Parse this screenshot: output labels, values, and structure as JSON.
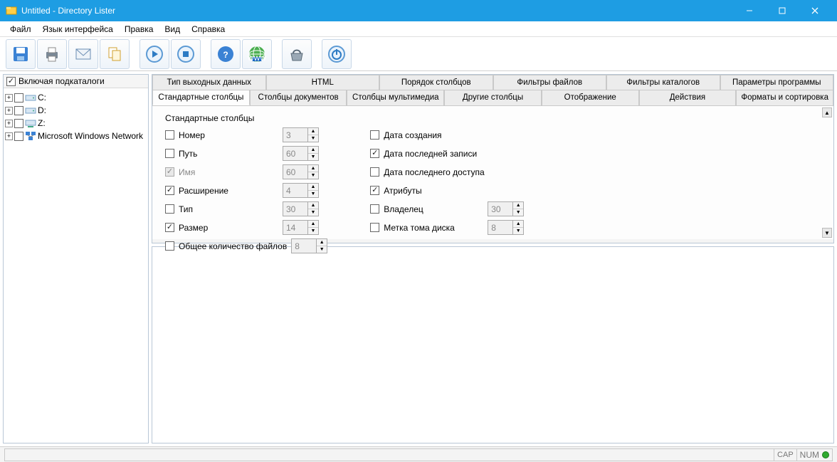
{
  "window": {
    "title": "Untitled - Directory Lister"
  },
  "menu": {
    "file": "Файл",
    "language": "Язык интерфейса",
    "edit": "Правка",
    "view": "Вид",
    "help": "Справка"
  },
  "toolbar_icons": {
    "save": "save-icon",
    "print": "print-icon",
    "email": "email-icon",
    "copy": "copy-icon",
    "run": "run-icon",
    "stop": "stop-icon",
    "help": "help-icon",
    "web": "web-icon",
    "basket": "basket-icon",
    "power": "power-icon"
  },
  "sidebar": {
    "include_subdirs": "Включая подкаталоги",
    "nodes": [
      {
        "label": "C:"
      },
      {
        "label": "D:"
      },
      {
        "label": "Z:"
      },
      {
        "label": "Microsoft Windows Network"
      }
    ]
  },
  "tabs": {
    "row1": [
      "Тип выходных данных",
      "HTML",
      "Порядок столбцов",
      "Фильтры файлов",
      "Фильтры каталогов",
      "Параметры программы"
    ],
    "row2": [
      "Стандартные столбцы",
      "Столбцы документов",
      "Столбцы мультимедиа",
      "Другие столбцы",
      "Отображение",
      "Действия",
      "Форматы и сортировка"
    ],
    "active": "Стандартные столбцы"
  },
  "group": {
    "title": "Стандартные столбцы"
  },
  "fields": {
    "number": {
      "label": "Номер",
      "checked": false,
      "value": "3",
      "enabled_spin": false
    },
    "path": {
      "label": "Путь",
      "checked": false,
      "value": "60",
      "enabled_spin": false
    },
    "name": {
      "label": "Имя",
      "checked": true,
      "disabled": true,
      "value": "60",
      "enabled_spin": false
    },
    "extension": {
      "label": "Расширение",
      "checked": true,
      "value": "4",
      "enabled_spin": false
    },
    "type": {
      "label": "Тип",
      "checked": false,
      "value": "30",
      "enabled_spin": false
    },
    "size": {
      "label": "Размер",
      "checked": true,
      "value": "14",
      "enabled_spin": false
    },
    "total_files": {
      "label": "Общее количество файлов",
      "checked": false,
      "value": "8",
      "enabled_spin": false
    },
    "date_created": {
      "label": "Дата создания",
      "checked": false
    },
    "date_modified": {
      "label": "Дата последней записи",
      "checked": true
    },
    "date_accessed": {
      "label": "Дата последнего доступа",
      "checked": false
    },
    "attributes": {
      "label": "Атрибуты",
      "checked": true
    },
    "owner": {
      "label": "Владелец",
      "checked": false,
      "value": "30",
      "enabled_spin": false
    },
    "volume_label": {
      "label": "Метка тома диска",
      "checked": false,
      "value": "8",
      "enabled_spin": false
    }
  },
  "status": {
    "cap": "CAP",
    "num": "NUM"
  }
}
